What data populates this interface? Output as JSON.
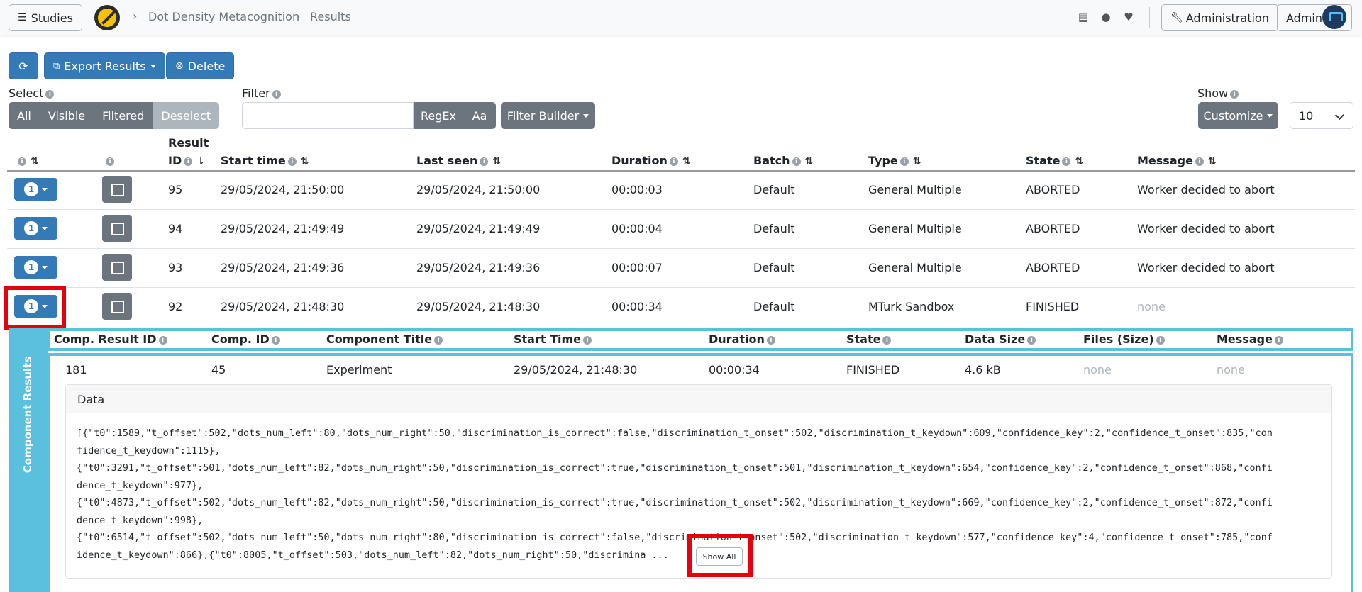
{
  "navbar": {
    "studies_label": "Studies",
    "breadcrumb": [
      "Dot Density Metacognition",
      "Results"
    ],
    "administration_label": "Administration",
    "user_label": "Admin"
  },
  "toolbar": {
    "export_label": "Export Results",
    "delete_label": "Delete"
  },
  "select": {
    "label": "Select",
    "options": [
      "All",
      "Visible",
      "Filtered",
      "Deselect"
    ]
  },
  "filter": {
    "label": "Filter",
    "value": "",
    "regex_label": "RegEx",
    "case_label": "Aa",
    "builder_label": "Filter Builder"
  },
  "show": {
    "label": "Show",
    "customize_label": "Customize",
    "page_size": "10"
  },
  "table": {
    "headers": {
      "result_id_line1": "Result",
      "result_id_line2": "ID",
      "start_time": "Start time",
      "last_seen": "Last seen",
      "duration": "Duration",
      "batch": "Batch",
      "type": "Type",
      "state": "State",
      "message": "Message"
    },
    "rows": [
      {
        "badge": "1",
        "id": "95",
        "start": "29/05/2024, 21:50:00",
        "last_seen": "29/05/2024, 21:50:00",
        "duration": "00:00:03",
        "batch": "Default",
        "type": "General Multiple",
        "state": "ABORTED",
        "message": "Worker decided to abort"
      },
      {
        "badge": "1",
        "id": "94",
        "start": "29/05/2024, 21:49:49",
        "last_seen": "29/05/2024, 21:49:49",
        "duration": "00:00:04",
        "batch": "Default",
        "type": "General Multiple",
        "state": "ABORTED",
        "message": "Worker decided to abort"
      },
      {
        "badge": "1",
        "id": "93",
        "start": "29/05/2024, 21:49:36",
        "last_seen": "29/05/2024, 21:49:36",
        "duration": "00:00:07",
        "batch": "Default",
        "type": "General Multiple",
        "state": "ABORTED",
        "message": "Worker decided to abort"
      },
      {
        "badge": "1",
        "id": "92",
        "start": "29/05/2024, 21:48:30",
        "last_seen": "29/05/2024, 21:48:30",
        "duration": "00:00:34",
        "batch": "Default",
        "type": "MTurk Sandbox",
        "state": "FINISHED",
        "message": "none"
      }
    ]
  },
  "component_results": {
    "side_label": "Component Results",
    "headers": {
      "comp_result_id": "Comp. Result ID",
      "comp_id": "Comp. ID",
      "title": "Component Title",
      "start_time": "Start Time",
      "duration": "Duration",
      "state": "State",
      "data_size": "Data Size",
      "files": "Files (Size)",
      "message": "Message"
    },
    "row": {
      "comp_result_id": "181",
      "comp_id": "45",
      "title": "Experiment",
      "start_time": "29/05/2024, 21:48:30",
      "duration": "00:00:34",
      "state": "FINISHED",
      "data_size": "4.6 kB",
      "files": "none",
      "message": "none"
    },
    "data_title": "Data",
    "data_lines": [
      "[{\"t0\":1589,\"t_offset\":502,\"dots_num_left\":80,\"dots_num_right\":50,\"discrimination_is_correct\":false,\"discrimination_t_onset\":502,\"discrimination_t_keydown\":609,\"confidence_key\":2,\"confidence_t_onset\":835,\"con",
      "fidence_t_keydown\":1115},",
      "{\"t0\":3291,\"t_offset\":501,\"dots_num_left\":82,\"dots_num_right\":50,\"discrimination_is_correct\":true,\"discrimination_t_onset\":501,\"discrimination_t_keydown\":654,\"confidence_key\":2,\"confidence_t_onset\":868,\"confi",
      "dence_t_keydown\":977},",
      "{\"t0\":4873,\"t_offset\":502,\"dots_num_left\":82,\"dots_num_right\":50,\"discrimination_is_correct\":true,\"discrimination_t_onset\":502,\"discrimination_t_keydown\":669,\"confidence_key\":2,\"confidence_t_onset\":872,\"confi",
      "dence_t_keydown\":998},",
      "{\"t0\":6514,\"t_offset\":502,\"dots_num_left\":50,\"dots_num_right\":80,\"discrimination_is_correct\":false,\"discrimination_t_onset\":502,\"discrimination_t_keydown\":577,\"confidence_key\":4,\"confidence_t_onset\":785,\"conf",
      "idence_t_keydown\":866},{\"t0\":8005,\"t_offset\":503,\"dots_num_left\":82,\"dots_num_right\":50,\"discrimina ..."
    ],
    "show_all_label": "Show All"
  },
  "colors": {
    "primary": "#337ab7",
    "secondary": "#6c757d",
    "info": "#5bc0de",
    "highlight": "#e6000e"
  }
}
